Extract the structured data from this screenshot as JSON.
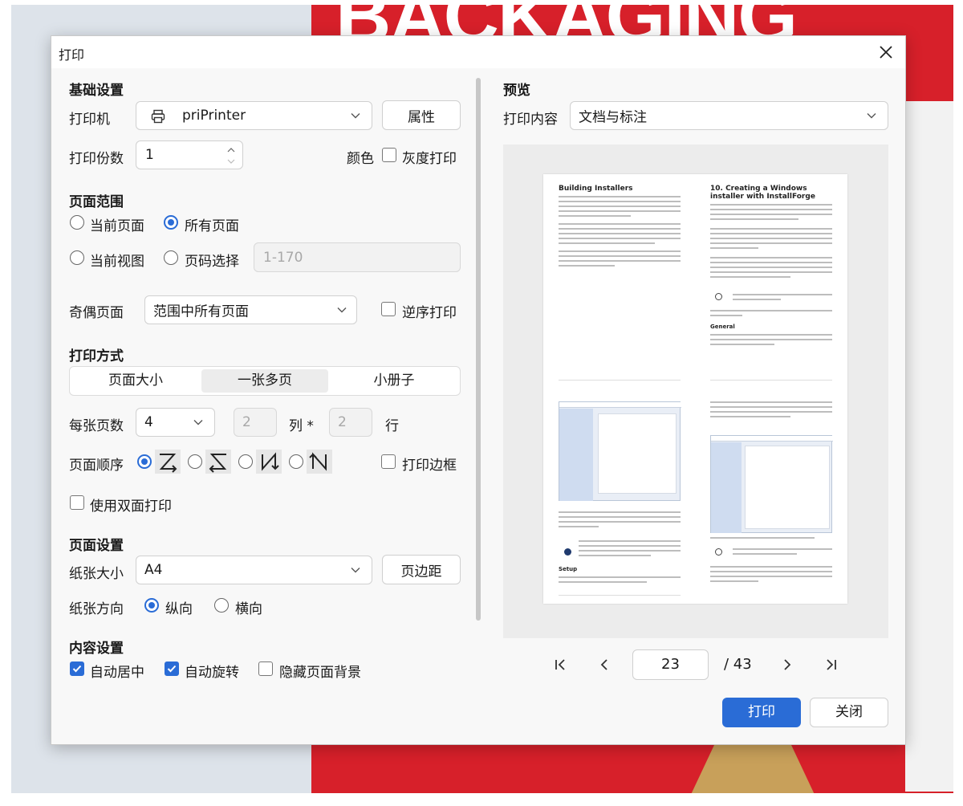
{
  "background": {
    "word": "BACKAGING"
  },
  "dialog": {
    "title": "打印",
    "basic": {
      "heading": "基础设置",
      "printer_label": "打印机",
      "printer_value": "priPrinter",
      "properties_button": "属性",
      "copies_label": "打印份数",
      "copies_value": "1",
      "color_label": "颜色",
      "grayscale_label": "灰度打印"
    },
    "range": {
      "heading": "页面范围",
      "current_page": "当前页面",
      "all_pages": "所有页面",
      "current_view": "当前视图",
      "page_select": "页码选择",
      "page_select_placeholder": "1-170",
      "odd_even_label": "奇偶页面",
      "odd_even_value": "范围中所有页面",
      "reverse_label": "逆序打印"
    },
    "mode": {
      "heading": "打印方式",
      "tabs": [
        "页面大小",
        "一张多页",
        "小册子"
      ],
      "per_sheet_label": "每张页数",
      "per_sheet_value": "4",
      "cols_value": "2",
      "cols_label": "列 *",
      "rows_value": "2",
      "rows_label": "行",
      "order_label": "页面顺序",
      "border_label": "打印边框",
      "duplex_label": "使用双面打印"
    },
    "page_setup": {
      "heading": "页面设置",
      "paper_label": "纸张大小",
      "paper_value": "A4",
      "margins_button": "页边距",
      "orientation_label": "纸张方向",
      "portrait": "纵向",
      "landscape": "横向"
    },
    "content": {
      "heading": "内容设置",
      "auto_center": "自动居中",
      "auto_rotate": "自动旋转",
      "hide_bg": "隐藏页面背景"
    },
    "preview": {
      "heading": "预览",
      "content_label": "打印内容",
      "content_value": "文档与标注",
      "page1_title": "Building Installers",
      "page2_title": "10. Creating a Windows installer with InstallForge",
      "page2_sub": "General",
      "page3_sub": "Setup"
    },
    "pager": {
      "current": "23",
      "total": "/ 43"
    },
    "print_button": "打印",
    "close_button": "关闭"
  }
}
